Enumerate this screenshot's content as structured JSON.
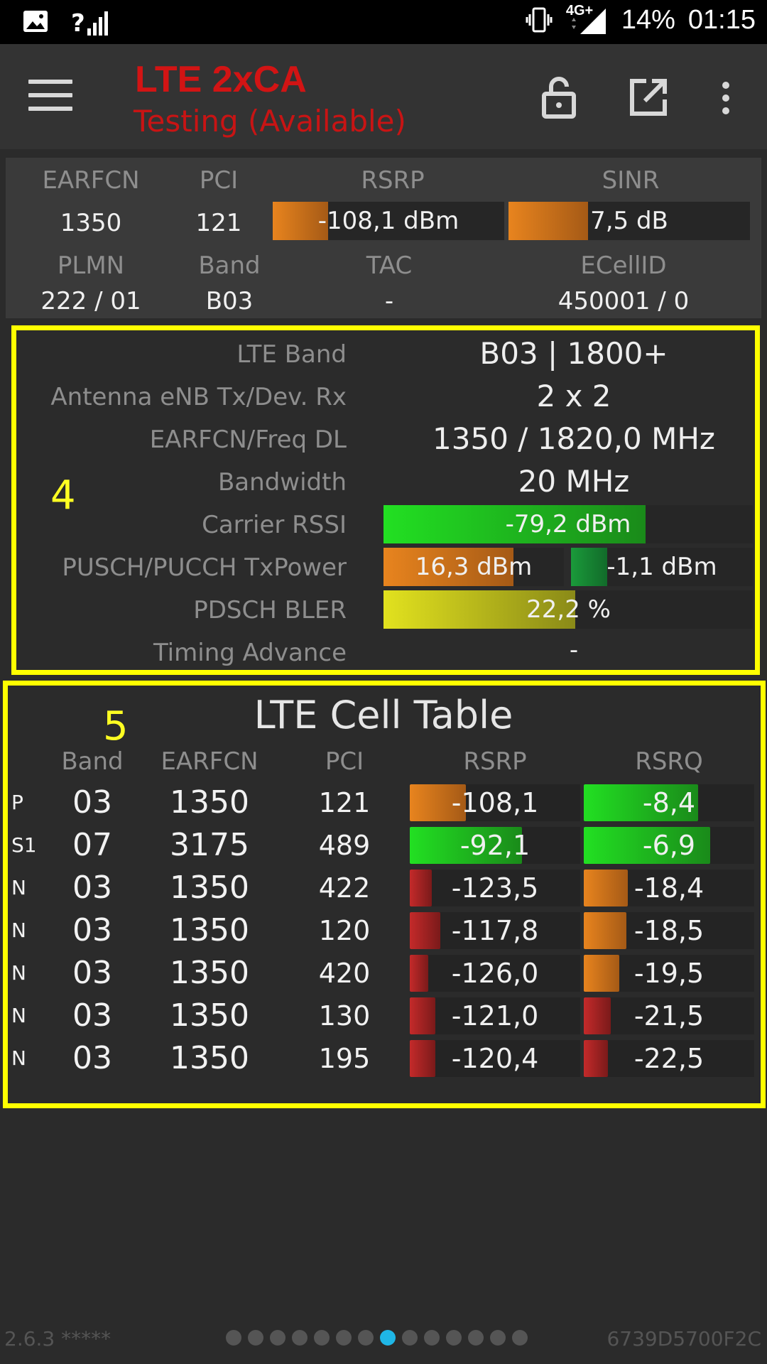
{
  "status_bar": {
    "signal_badge": "?",
    "network": "4G+",
    "battery": "14%",
    "time": "01:15"
  },
  "app_bar": {
    "title": "LTE 2xCA",
    "subtitle": "Testing (Available)"
  },
  "summary": {
    "headers_row1": [
      "EARFCN",
      "PCI",
      "RSRP",
      "SINR"
    ],
    "earfcn": "1350",
    "pci": "121",
    "rsrp": "-108,1 dBm",
    "rsrp_level": 0.24,
    "sinr": "7,5 dB",
    "sinr_level": 0.33,
    "headers_row2": [
      "PLMN",
      "Band",
      "TAC",
      "ECellID"
    ],
    "plmn": "222 / 01",
    "band": "B03",
    "tac": "-",
    "ecellid": "450001 / 0"
  },
  "carrier": {
    "index": "4",
    "rows": {
      "lte_band": {
        "label": "LTE Band",
        "value": "B03 | 1800+"
      },
      "antenna": {
        "label": "Antenna eNB Tx/Dev. Rx",
        "value": "2 x 2"
      },
      "earfcn_freq": {
        "label": "EARFCN/Freq DL",
        "value": "1350 / 1820,0 MHz"
      },
      "bandwidth": {
        "label": "Bandwidth",
        "value": "20 MHz"
      },
      "rssi": {
        "label": "Carrier RSSI",
        "value": "-79,2 dBm",
        "level": 0.71
      },
      "txpower": {
        "label": "PUSCH/PUCCH TxPower",
        "pusch": "16,3 dBm",
        "pusch_level": 0.72,
        "pucch": "-1,1 dBm",
        "pucch_level": 0.2
      },
      "bler": {
        "label": "PDSCH BLER",
        "value": "22,2 %",
        "level": 0.52
      },
      "ta": {
        "label": "Timing Advance",
        "value": "-"
      }
    }
  },
  "cell_table": {
    "index": "5",
    "title": "LTE Cell Table",
    "columns": [
      "Band",
      "EARFCN",
      "PCI",
      "RSRP",
      "RSRQ"
    ],
    "rows": [
      {
        "type": "P",
        "band": "03",
        "earfcn": "1350",
        "pci": "121",
        "rsrp": "-108,1",
        "rsrp_level": 0.33,
        "rsrp_color": "orange",
        "rsrq": "-8,4",
        "rsrq_level": 0.67,
        "rsrq_color": "green"
      },
      {
        "type": "S1",
        "band": "07",
        "earfcn": "3175",
        "pci": "489",
        "rsrp": "-92,1",
        "rsrp_level": 0.66,
        "rsrp_color": "green",
        "rsrq": "-6,9",
        "rsrq_level": 0.74,
        "rsrq_color": "green"
      },
      {
        "type": "N",
        "band": "03",
        "earfcn": "1350",
        "pci": "422",
        "rsrp": "-123,5",
        "rsrp_level": 0.13,
        "rsrp_color": "red",
        "rsrq": "-18,4",
        "rsrq_level": 0.26,
        "rsrq_color": "orange"
      },
      {
        "type": "N",
        "band": "03",
        "earfcn": "1350",
        "pci": "120",
        "rsrp": "-117,8",
        "rsrp_level": 0.18,
        "rsrp_color": "red",
        "rsrq": "-18,5",
        "rsrq_level": 0.25,
        "rsrq_color": "orange"
      },
      {
        "type": "N",
        "band": "03",
        "earfcn": "1350",
        "pci": "420",
        "rsrp": "-126,0",
        "rsrp_level": 0.11,
        "rsrp_color": "red",
        "rsrq": "-19,5",
        "rsrq_level": 0.21,
        "rsrq_color": "orange"
      },
      {
        "type": "N",
        "band": "03",
        "earfcn": "1350",
        "pci": "130",
        "rsrp": "-121,0",
        "rsrp_level": 0.15,
        "rsrp_color": "red",
        "rsrq": "-21,5",
        "rsrq_level": 0.16,
        "rsrq_color": "red"
      },
      {
        "type": "N",
        "band": "03",
        "earfcn": "1350",
        "pci": "195",
        "rsrp": "-120,4",
        "rsrp_level": 0.15,
        "rsrp_color": "red",
        "rsrq": "-22,5",
        "rsrq_level": 0.14,
        "rsrq_color": "red"
      }
    ]
  },
  "footer": {
    "version": "2.6.3 *****",
    "device_id": "6739D5700F2C",
    "page_count": 14,
    "active_page": 8
  },
  "colors": {
    "accent_red": "#d21414",
    "highlight": "#ffff00",
    "page_dot_active": "#1fb6e6",
    "orange": "#e8841e",
    "green": "#1ec81e",
    "red": "#b42323",
    "yellow": "#d6d61e"
  }
}
